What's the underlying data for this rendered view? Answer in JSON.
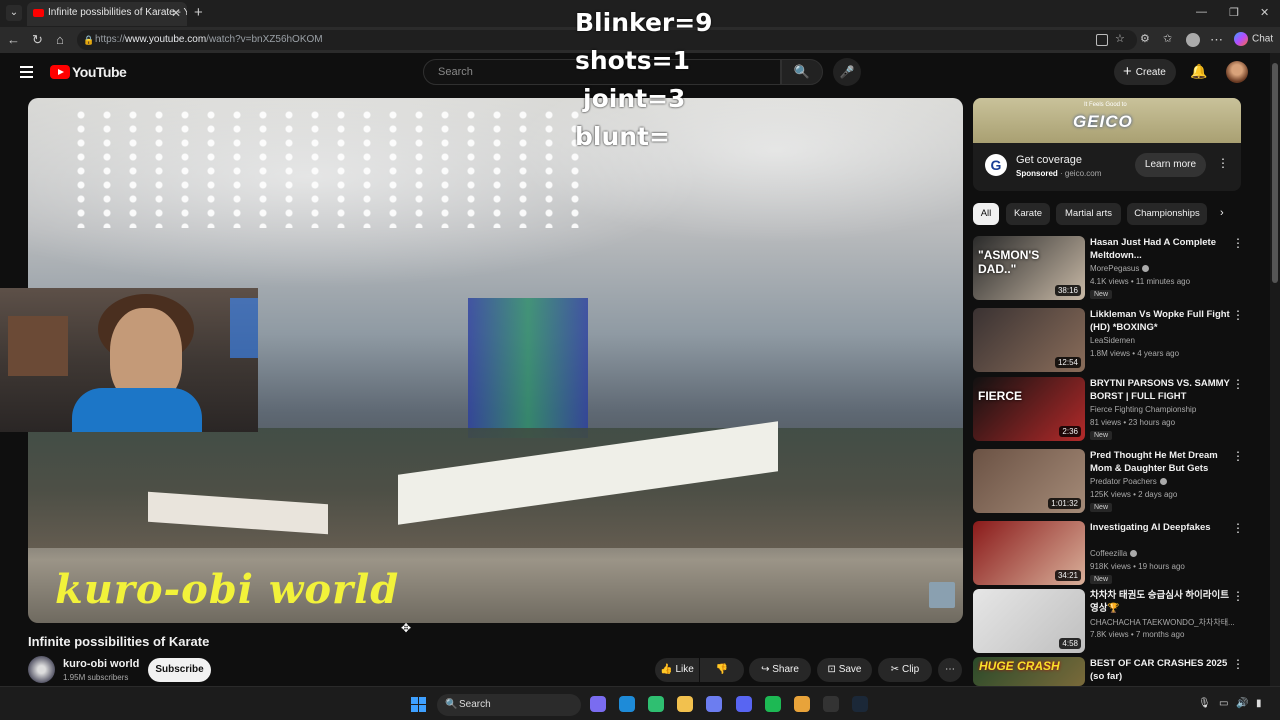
{
  "browser": {
    "tab_title": "Infinite possibilities of Karate - YouTube",
    "url_prefix": "https://",
    "url_host": "www.youtube.com",
    "url_path": "/watch?v=bnXZ56hOKOM",
    "chat_label": "Chat"
  },
  "overlay": {
    "line1": "Blinker=9",
    "line2": "shots=1",
    "line3": "joint=3",
    "line4": "blunt="
  },
  "header": {
    "logo_text": "YouTube",
    "search_placeholder": "Search",
    "create_label": "Create"
  },
  "video": {
    "watermark": "kuro-obi world",
    "title": "Infinite possibilities of Karate",
    "channel_name": "kuro-obi world",
    "subscribers": "1.95M subscribers",
    "subscribe_label": "Subscribe",
    "like_label": "Like",
    "share_label": "Share",
    "save_label": "Save",
    "clip_label": "Clip"
  },
  "ad": {
    "brand": "GEICO",
    "tagline": "It Feels Good to",
    "title": "Get coverage",
    "sponsored": "Sponsored",
    "domain": "geico.com",
    "cta": "Learn more"
  },
  "chips": [
    "All",
    "Karate",
    "Martial arts",
    "Championships"
  ],
  "recommendations": [
    {
      "title": "Hasan Just Had A Complete Meltdown...",
      "channel": "MorePegasus",
      "meta": "4.1K views • 11 minutes ago",
      "badge": "New",
      "duration": "38:16",
      "thumb_text": "\"ASMON'S DAD..\"",
      "colors": [
        "#2a2a2a",
        "#c8b9a6"
      ]
    },
    {
      "title": "Likkleman Vs Wopke Full Fight (HD) *BOXING*",
      "channel": "LeaSidemen",
      "meta": "1.8M views • 4 years ago",
      "badge": "",
      "duration": "12:54",
      "thumb_text": "",
      "colors": [
        "#3a3232",
        "#8a6d5a"
      ]
    },
    {
      "title": "BRYTNI PARSONS VS. SAMMY BORST | FULL FIGHT",
      "channel": "Fierce Fighting Championship",
      "meta": "81 views • 23 hours ago",
      "badge": "New",
      "duration": "2:36",
      "thumb_text": "FIERCE",
      "colors": [
        "#111111",
        "#b32a2a"
      ]
    },
    {
      "title": "Pred Thought He Met Dream Mom & Daughter But Gets Fac...",
      "channel": "Predator Poachers",
      "meta": "125K views • 2 days ago",
      "badge": "New",
      "duration": "1:01:32",
      "thumb_text": "",
      "colors": [
        "#6b5244",
        "#a58b78"
      ]
    },
    {
      "title": "Investigating AI Deepfakes",
      "channel": "Coffeezilla",
      "meta": "918K views • 19 hours ago",
      "badge": "New",
      "duration": "34:21",
      "thumb_text": "",
      "colors": [
        "#8a1a1a",
        "#d9b09a"
      ]
    },
    {
      "title": "차차차 태권도 승급심사 하이라이트 영상🏆",
      "channel": "CHACHACHA TAEKWONDO_차차차태...",
      "meta": "7.8K views • 7 months ago",
      "badge": "",
      "duration": "4:58",
      "thumb_text": "",
      "colors": [
        "#e6e6e6",
        "#bfbfbf"
      ]
    },
    {
      "title": "BEST OF CAR CRASHES 2025 (so far)",
      "channel": "",
      "meta": "",
      "badge": "",
      "duration": "",
      "thumb_text": "HUGE CRASH",
      "colors": [
        "#2a4a2a",
        "#7a6a3a"
      ]
    }
  ],
  "taskbar": {
    "search_label": "Search",
    "apps": [
      "#7a6cf0",
      "#1e8bd8",
      "#2fbf71",
      "#f2c14e",
      "#6c7df0",
      "#5865f2",
      "#1db954",
      "#e8a33a",
      "#333333",
      "#1b2838"
    ]
  }
}
